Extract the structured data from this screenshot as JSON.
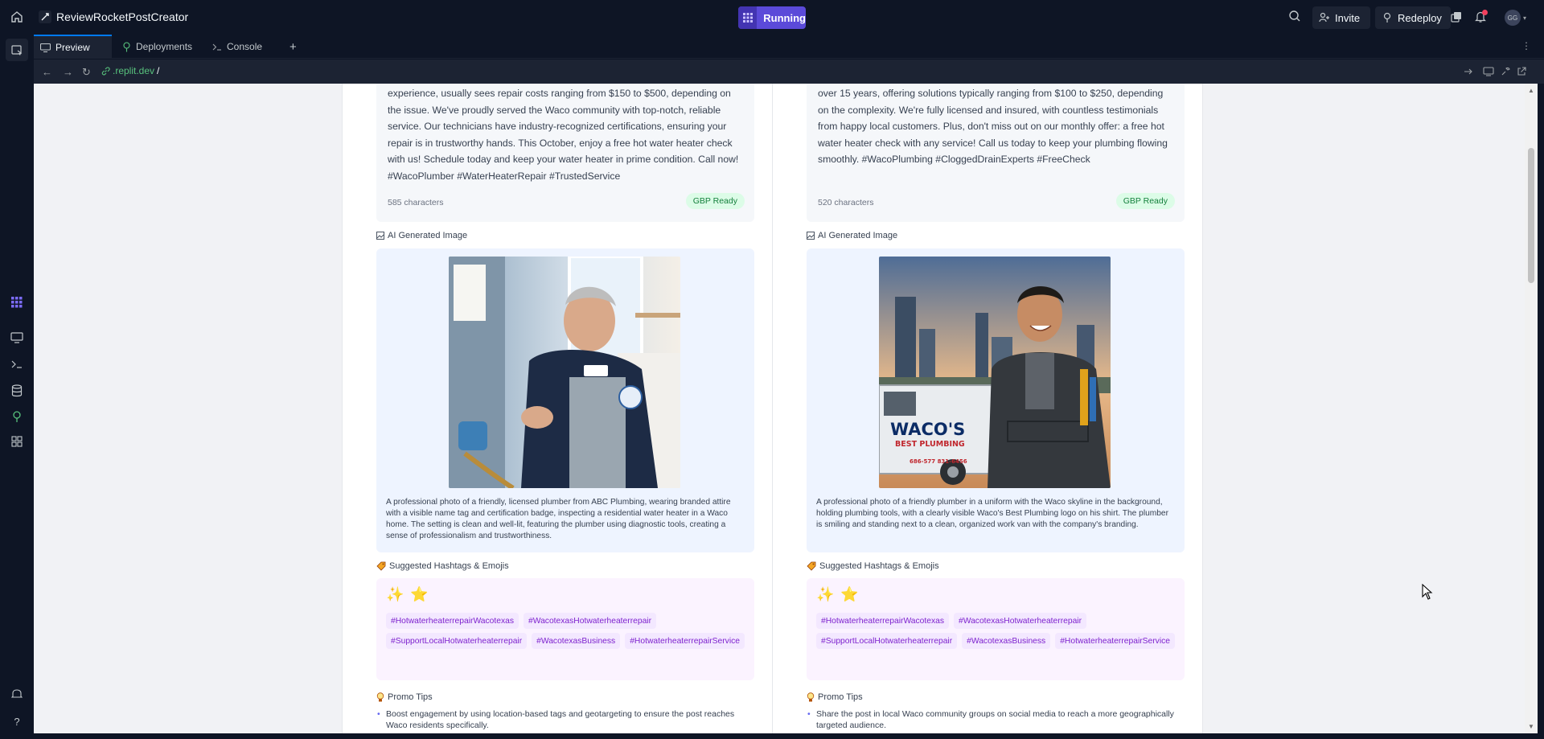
{
  "topbar": {
    "app_title": "ReviewRocketPostCreator",
    "run_label": "Running",
    "invite_label": "Invite",
    "redeploy_label": "Redeploy",
    "avatar_initials": "GG"
  },
  "tabs": [
    {
      "label": "Preview",
      "icon": "monitor-icon"
    },
    {
      "label": "Deployments",
      "icon": "deploy-icon"
    },
    {
      "label": "Console",
      "icon": "terminal-icon"
    }
  ],
  "url": {
    "host": ".replit.dev",
    "path": "/"
  },
  "posts": [
    {
      "text": "experience, usually sees repair costs ranging from $150 to $500, depending on the issue. We've proudly served the Waco community with top-notch, reliable service. Our technicians have industry-recognized certifications, ensuring your repair is in trustworthy hands. This October, enjoy a free hot water heater check with us! Schedule today and keep your water heater in prime condition. Call now! #WacoPlumber #WaterHeaterRepair #TrustedService",
      "char_count": "585 characters",
      "badge": "GBP Ready",
      "image_heading": "AI Generated Image",
      "image_caption": "A professional photo of a friendly, licensed plumber from ABC Plumbing, wearing branded attire with a visible name tag and certification badge, inspecting a residential water heater in a Waco home. The setting is clean and well-lit, featuring the plumber using diagnostic tools, creating a sense of professionalism and trustworthiness.",
      "hashtag_heading": "Suggested Hashtags & Emojis",
      "emojis": [
        "✨",
        "⭐"
      ],
      "hashtags": [
        "#HotwaterheaterrepairWacotexas",
        "#WacotexasHotwaterheaterrepair",
        "#SupportLocalHotwaterheaterrepair",
        "#WacotexasBusiness",
        "#HotwaterheaterrepairService"
      ],
      "tips_heading": "Promo Tips",
      "tip": "Boost engagement by using location-based tags and geotargeting to ensure the post reaches Waco residents specifically."
    },
    {
      "text": "over 15 years, offering solutions typically ranging from $100 to $250, depending on the complexity. We're fully licensed and insured, with countless testimonials from happy local customers. Plus, don't miss out on our monthly offer: a free hot water heater check with any service! Call us today to keep your plumbing flowing smoothly. #WacoPlumbing #CloggedDrainExperts #FreeCheck",
      "char_count": "520 characters",
      "badge": "GBP Ready",
      "image_heading": "AI Generated Image",
      "image_caption": "A professional photo of a friendly plumber in a uniform with the Waco skyline in the background, holding plumbing tools, with a clearly visible Waco's Best Plumbing logo on his shirt. The plumber is smiling and standing next to a clean, organized work van with the company's branding.",
      "van_logo_line1": "WACO'S",
      "van_logo_line2": "BEST PLUMBING",
      "van_phone": "686-577 831-6456",
      "hashtag_heading": "Suggested Hashtags & Emojis",
      "emojis": [
        "✨",
        "⭐"
      ],
      "hashtags": [
        "#HotwaterheaterrepairWacotexas",
        "#WacotexasHotwaterheaterrepair",
        "#SupportLocalHotwaterheaterrepair",
        "#WacotexasBusiness",
        "#HotwaterheaterrepairService"
      ],
      "tips_heading": "Promo Tips",
      "tip": "Share the post in local Waco community groups on social media to reach a more geographically targeted audience."
    }
  ],
  "colors": {
    "ide_bg": "#0e1525",
    "run_button": "#5b4ad9",
    "badge_green": "#15803d",
    "tag_purple": "#7e22ce"
  }
}
